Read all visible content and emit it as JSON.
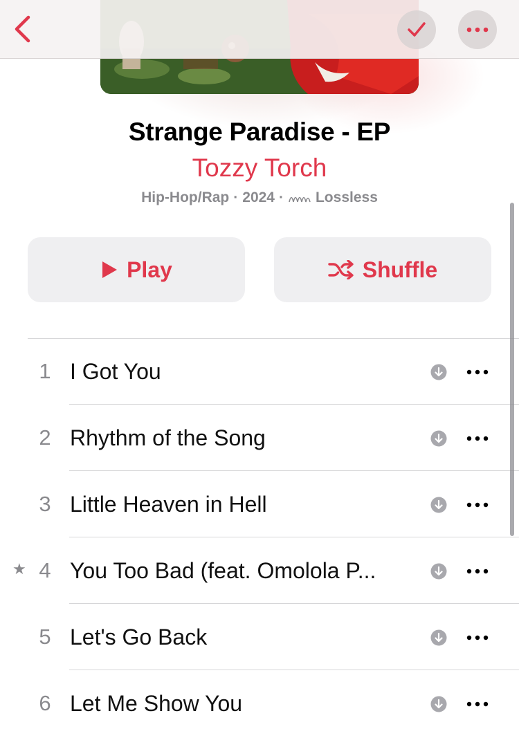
{
  "album": {
    "title": "Strange Paradise - EP",
    "artist": "Tozzy Torch",
    "genre": "Hip-Hop/Rap",
    "separator": "·",
    "year": "2024",
    "quality": "Lossless",
    "artwork_icon": "album-artwork"
  },
  "nav": {
    "back_icon": "chevron-left-icon",
    "check_icon": "checkmark-icon",
    "more_icon": "ellipsis-icon"
  },
  "actions": {
    "play_label": "Play",
    "shuffle_label": "Shuffle"
  },
  "tracks": [
    {
      "number": "1",
      "title": "I Got You",
      "starred": false
    },
    {
      "number": "2",
      "title": "Rhythm of the Song",
      "starred": false
    },
    {
      "number": "3",
      "title": "Little Heaven in Hell",
      "starred": false
    },
    {
      "number": "4",
      "title": "You Too Bad (feat. Omolola P...",
      "starred": true,
      "star": "★"
    },
    {
      "number": "5",
      "title": "Let's Go Back",
      "starred": false
    },
    {
      "number": "6",
      "title": "Let Me Show You",
      "starred": false
    }
  ],
  "colors": {
    "accent": "#e0384c",
    "secondary_text": "#8a8a8e",
    "button_bg": "#efeff1"
  }
}
